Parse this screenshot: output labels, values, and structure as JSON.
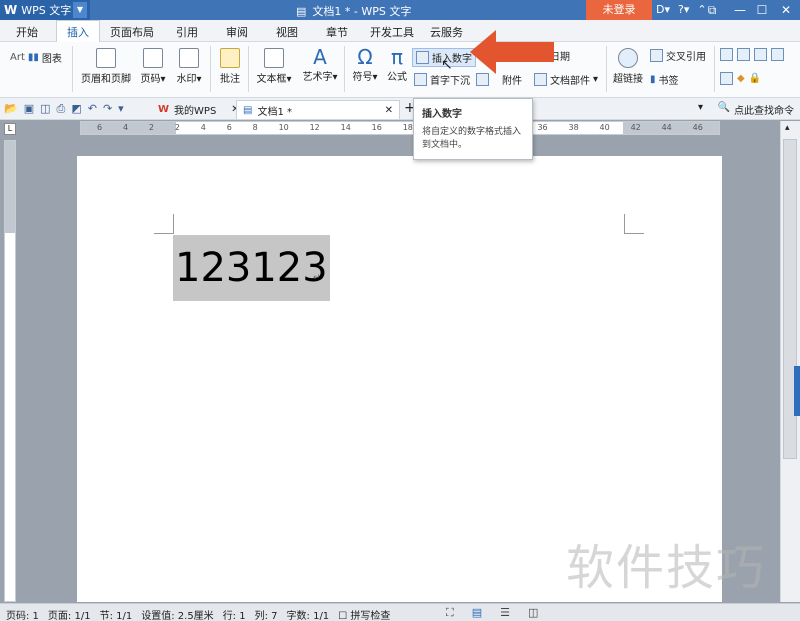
{
  "titlebar": {
    "app_logo": "W",
    "app_name": "WPS 文字",
    "doc_title": "文档1 * - WPS 文字",
    "login": "未登录",
    "icons": [
      "D▾",
      "?▾",
      "⌃"
    ]
  },
  "menu_tabs": [
    "开始",
    "插入",
    "页面布局",
    "引用",
    "审阅",
    "视图",
    "章节",
    "开发工具",
    "云服务"
  ],
  "active_menu": "插入",
  "ribbon": {
    "art_label": "Art",
    "chart_label": "图表",
    "header_footer": "页眉和页脚",
    "page_num": "页码",
    "watermark": "水印",
    "annotation": "批注",
    "textbox": "文本框",
    "wordart": "艺术字",
    "symbol": "符号",
    "formula": "公式",
    "insert_number": "插入数字",
    "drop_cap": "首字下沉",
    "attachment": "附件",
    "date": "日期",
    "doc_parts": "文档部件",
    "hyperlink": "超链接",
    "cross_ref": "交叉引用",
    "bookmark": "书签"
  },
  "doc_tabs": [
    {
      "label": "我的WPS"
    },
    {
      "label": "文档1 *"
    }
  ],
  "command_search": "点此查找命令",
  "ruler_ticks": [
    "6",
    "4",
    "2",
    "2",
    "4",
    "6",
    "8",
    "10",
    "12",
    "14",
    "16",
    "18",
    "20",
    "",
    "",
    "34",
    "36",
    "38",
    "40",
    "42",
    "44",
    "46"
  ],
  "document": {
    "text": "123123"
  },
  "tooltip": {
    "title": "插入数字",
    "body": "将自定义的数字格式插入到文档中。"
  },
  "status": {
    "page": "页码: 1",
    "pages": "页面: 1/1",
    "section": "节: 1/1",
    "setting": "设置值: 2.5厘米",
    "row": "行: 1",
    "col": "列: 7",
    "chars": "字数: 1/1",
    "spell": "拼写检查"
  },
  "watermark_text": "软件技巧",
  "colors": {
    "title_blue": "#3f74b6",
    "login_orange": "#e9663f",
    "arrow_red": "#e2552f",
    "selection_gray": "#c6c6c6"
  }
}
